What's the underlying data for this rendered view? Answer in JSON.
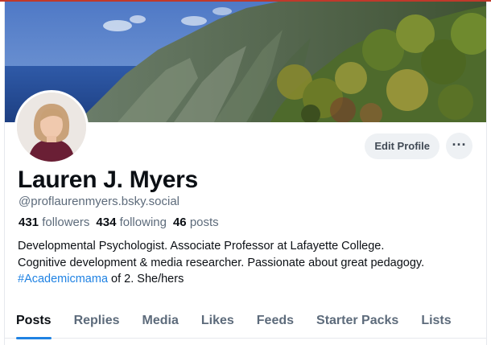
{
  "profile": {
    "display_name": "Lauren J. Myers",
    "handle": "@proflaurenmyers.bsky.social",
    "stats": {
      "followers_count": "431",
      "followers_label": "followers",
      "following_count": "434",
      "following_label": "following",
      "posts_count": "46",
      "posts_label": "posts"
    },
    "bio": {
      "line1": "Developmental Psychologist. Associate Professor at Lafayette College.",
      "line2": "Cognitive development & media researcher. Passionate about great pedagogy.",
      "hashtag": "#Academicmama",
      "line3_rest": " of 2. She/hers"
    }
  },
  "actions": {
    "edit_profile_label": "Edit Profile",
    "more_icon": "ellipsis-icon",
    "more_label": "···"
  },
  "tabs": [
    {
      "label": "Posts",
      "active": true
    },
    {
      "label": "Replies",
      "active": false
    },
    {
      "label": "Media",
      "active": false
    },
    {
      "label": "Likes",
      "active": false
    },
    {
      "label": "Feeds",
      "active": false
    },
    {
      "label": "Starter Packs",
      "active": false
    },
    {
      "label": "Lists",
      "active": false
    }
  ],
  "colors": {
    "accent": "#1f82e3",
    "muted_text": "#5d6b7b",
    "button_bg": "#eef1f4",
    "top_border": "#c0392b"
  }
}
